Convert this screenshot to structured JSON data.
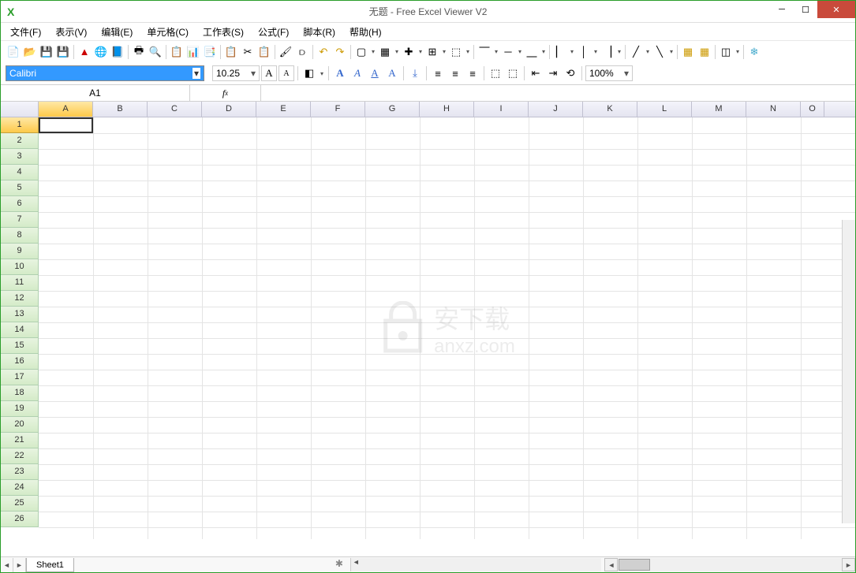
{
  "window": {
    "title": "无题 - Free Excel Viewer V2",
    "app_icon": "X"
  },
  "menu": {
    "items": [
      "文件(F)",
      "表示(V)",
      "编辑(E)",
      "单元格(C)",
      "工作表(S)",
      "公式(F)",
      "脚本(R)",
      "帮助(H)"
    ]
  },
  "font": {
    "name": "Calibri",
    "size": "10.25"
  },
  "zoom": "100%",
  "cell_ref": "A1",
  "fx_label": "fx",
  "columns": [
    "A",
    "B",
    "C",
    "D",
    "E",
    "F",
    "G",
    "H",
    "I",
    "J",
    "K",
    "L",
    "M",
    "N",
    "O"
  ],
  "rows": [
    "1",
    "2",
    "3",
    "4",
    "5",
    "6",
    "7",
    "8",
    "9",
    "10",
    "11",
    "12",
    "13",
    "14",
    "15",
    "16",
    "17",
    "18",
    "19",
    "20",
    "21",
    "22",
    "23",
    "24",
    "25",
    "26"
  ],
  "sheet_tab": "Sheet1",
  "watermark": {
    "text": "安下载",
    "domain": "anxz.com"
  }
}
